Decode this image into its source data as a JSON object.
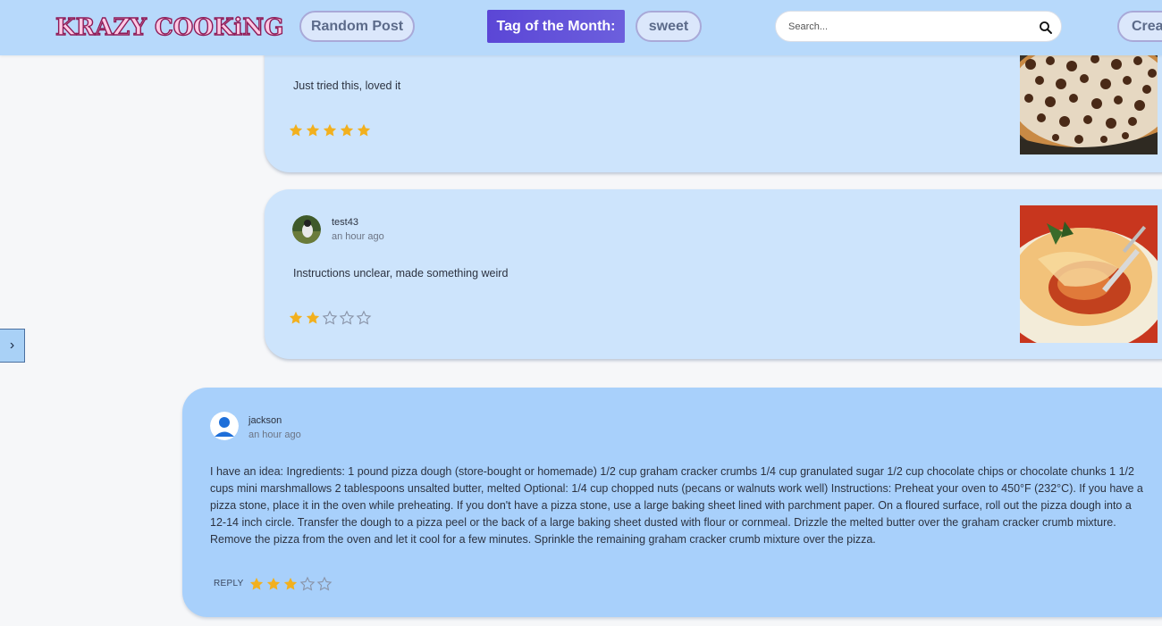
{
  "header": {
    "logo_text": "KRAZY COOKiNG",
    "random_post_label": "Random Post",
    "tag_of_month_label": "Tag of the Month:",
    "tag_value": "sweet",
    "search_placeholder": "Search...",
    "create_label": "Creat"
  },
  "sidebar_toggle": {
    "label": "›"
  },
  "comments": [
    {
      "text": "Just tried this, loved it",
      "rating": 5,
      "rating_max": 5,
      "has_image": true,
      "image_icon": "dessert-pizza-photo"
    },
    {
      "author": "test43",
      "time": "an hour ago",
      "text": "Instructions unclear, made something weird",
      "rating": 2,
      "rating_max": 5,
      "has_image": true,
      "image_icon": "cheesy-pasta-photo",
      "avatar_icon": "user-photo-avatar"
    },
    {
      "author": "jackson",
      "time": "an hour ago",
      "text": "I have an idea: Ingredients: 1 pound pizza dough (store-bought or homemade) 1/2 cup graham cracker crumbs 1/4 cup granulated sugar 1/2 cup chocolate chips or chocolate chunks 1 1/2 cups mini marshmallows 2 tablespoons unsalted butter, melted Optional: 1/4 cup chopped nuts (pecans or walnuts work well) Instructions: Preheat your oven to 450°F (232°C). If you have a pizza stone, place it in the oven while preheating. If you don't have a pizza stone, use a large baking sheet lined with parchment paper. On a floured surface, roll out the pizza dough into a 12-14 inch circle. Transfer the dough to a pizza peel or the back of a large baking sheet dusted with flour or cornmeal. Drizzle the melted butter over the graham cracker crumb mixture. Remove the pizza from the oven and let it cool for a few minutes. Sprinkle the remaining graham cracker crumb mixture over the pizza.",
      "reply_label": "REPLY",
      "rating": 3,
      "rating_max": 5,
      "avatar_icon": "default-user-avatar"
    }
  ],
  "colors": {
    "header_bg": "#b7d9fb",
    "tag_month_bg": "#5b46d6",
    "card_light": "#cde4fc",
    "card_dark": "#a8d0fb",
    "star_filled": "#f2b01e",
    "star_empty": "#8a94a8",
    "logo_fill": "#ffc9e4",
    "logo_stroke": "#8e1c58"
  }
}
